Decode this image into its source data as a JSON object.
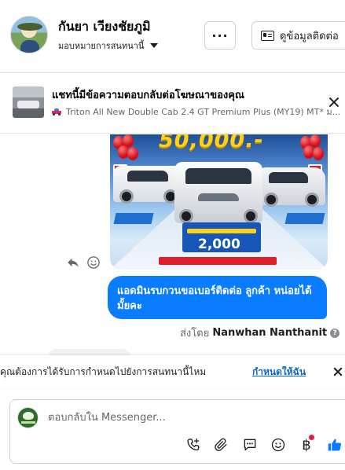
{
  "header": {
    "contact_name": "กันยา เวียงชัยภูมิ",
    "assign_label": "มอบหมายการสนทนานี้",
    "more_label": "···",
    "contact_info_label": "ดูข้อมูลติดต่อ"
  },
  "ad_banner": {
    "title": "แชทนี้มีข้อความตอบกลับต่อโฆษณาของคุณ",
    "subtitle": "Triton All New Double Cab 2.4 GT Premium Plus (MY19) MT* ม..."
  },
  "promo_image": {
    "price_text": "50,000.-",
    "amount_text": "2,000"
  },
  "messages": [
    {
      "text": "แอดมินรบกวนขอเบอร์ติดต่อ ลูกค้า  หน่อยได้มั้ยคะ",
      "sent_prefix": "ส่งโดย",
      "sender": "Nanwhan Nanthanit"
    }
  ],
  "assign_prompt": {
    "question": "คุณต้องการได้รับการกำหนดไปยังการสนทนานี้ไหม",
    "link": "กำหนดให้ฉัน"
  },
  "composer": {
    "placeholder": "ตอบกลับใน Messenger..."
  },
  "colors": {
    "bubble": "#0a7cff",
    "link": "#0a66c2",
    "like": "#0a7cff"
  }
}
